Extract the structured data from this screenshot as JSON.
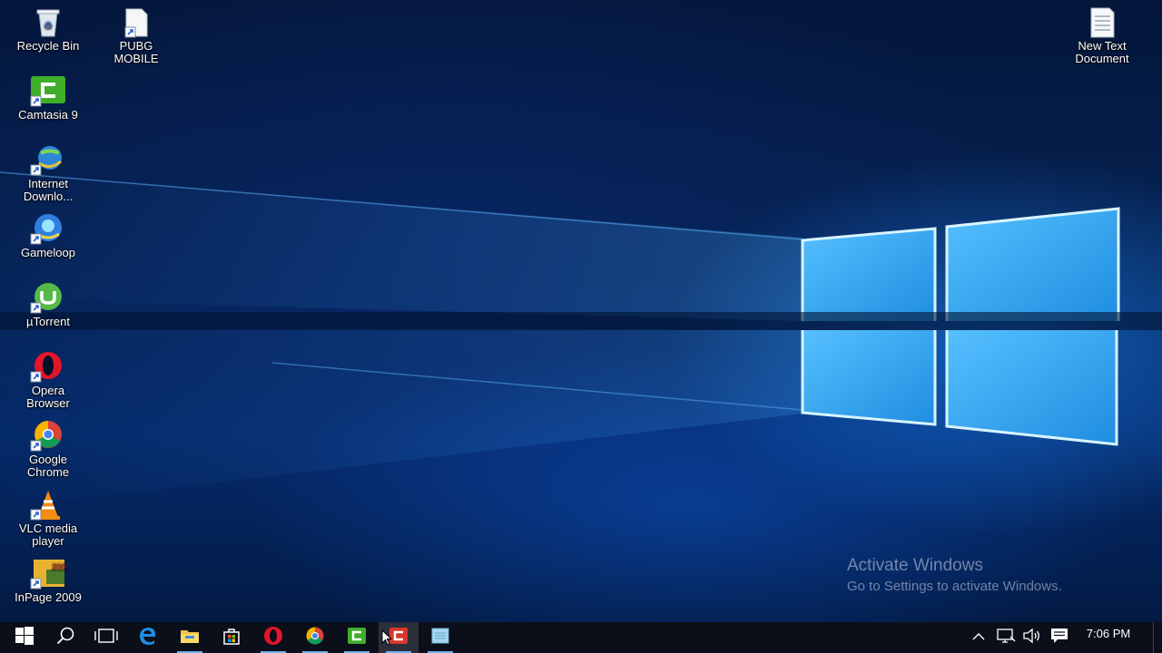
{
  "desktop": {
    "icons": [
      {
        "label": "Recycle Bin",
        "icon": "recycle-bin-icon"
      },
      {
        "label": "PUBG\nMOBILE",
        "icon": "pubg-mobile-icon"
      },
      {
        "label": "Camtasia 9",
        "icon": "camtasia-icon"
      },
      {
        "label": "Internet\nDownlo...",
        "icon": "internet-download-manager-icon"
      },
      {
        "label": "Gameloop",
        "icon": "gameloop-icon"
      },
      {
        "label": "µTorrent",
        "icon": "utorrent-icon"
      },
      {
        "label": "Opera\nBrowser",
        "icon": "opera-icon"
      },
      {
        "label": "Google\nChrome",
        "icon": "chrome-icon"
      },
      {
        "label": "VLC media\nplayer",
        "icon": "vlc-icon"
      },
      {
        "label": "InPage 2009",
        "icon": "inpage-icon"
      },
      {
        "label": "New Text\nDocument",
        "icon": "text-document-icon"
      }
    ]
  },
  "watermark": {
    "title": "Activate Windows",
    "subtitle": "Go to Settings to activate Windows."
  },
  "taskbar": {
    "buttons": [
      {
        "name": "start",
        "icon": "windows-logo-icon"
      },
      {
        "name": "search",
        "icon": "search-icon"
      },
      {
        "name": "task-view",
        "icon": "task-view-icon"
      },
      {
        "name": "edge",
        "icon": "edge-icon"
      },
      {
        "name": "file-explorer",
        "icon": "folder-icon"
      },
      {
        "name": "store",
        "icon": "store-icon"
      },
      {
        "name": "opera",
        "icon": "opera-icon"
      },
      {
        "name": "chrome",
        "icon": "chrome-icon"
      },
      {
        "name": "camtasia",
        "icon": "camtasia-icon"
      },
      {
        "name": "camtasia-recorder",
        "icon": "camtasia-recorder-icon"
      },
      {
        "name": "notepad",
        "icon": "notepad-icon"
      }
    ],
    "tray": {
      "icons": [
        "chevron-up-icon",
        "network-icon",
        "volume-icon",
        "notification-icon"
      ],
      "clock": "7:06 PM"
    }
  },
  "colors": {
    "accent": "#0a78d7",
    "taskbar": "#0b0f19",
    "running_indicator": "#6fb0ea"
  }
}
